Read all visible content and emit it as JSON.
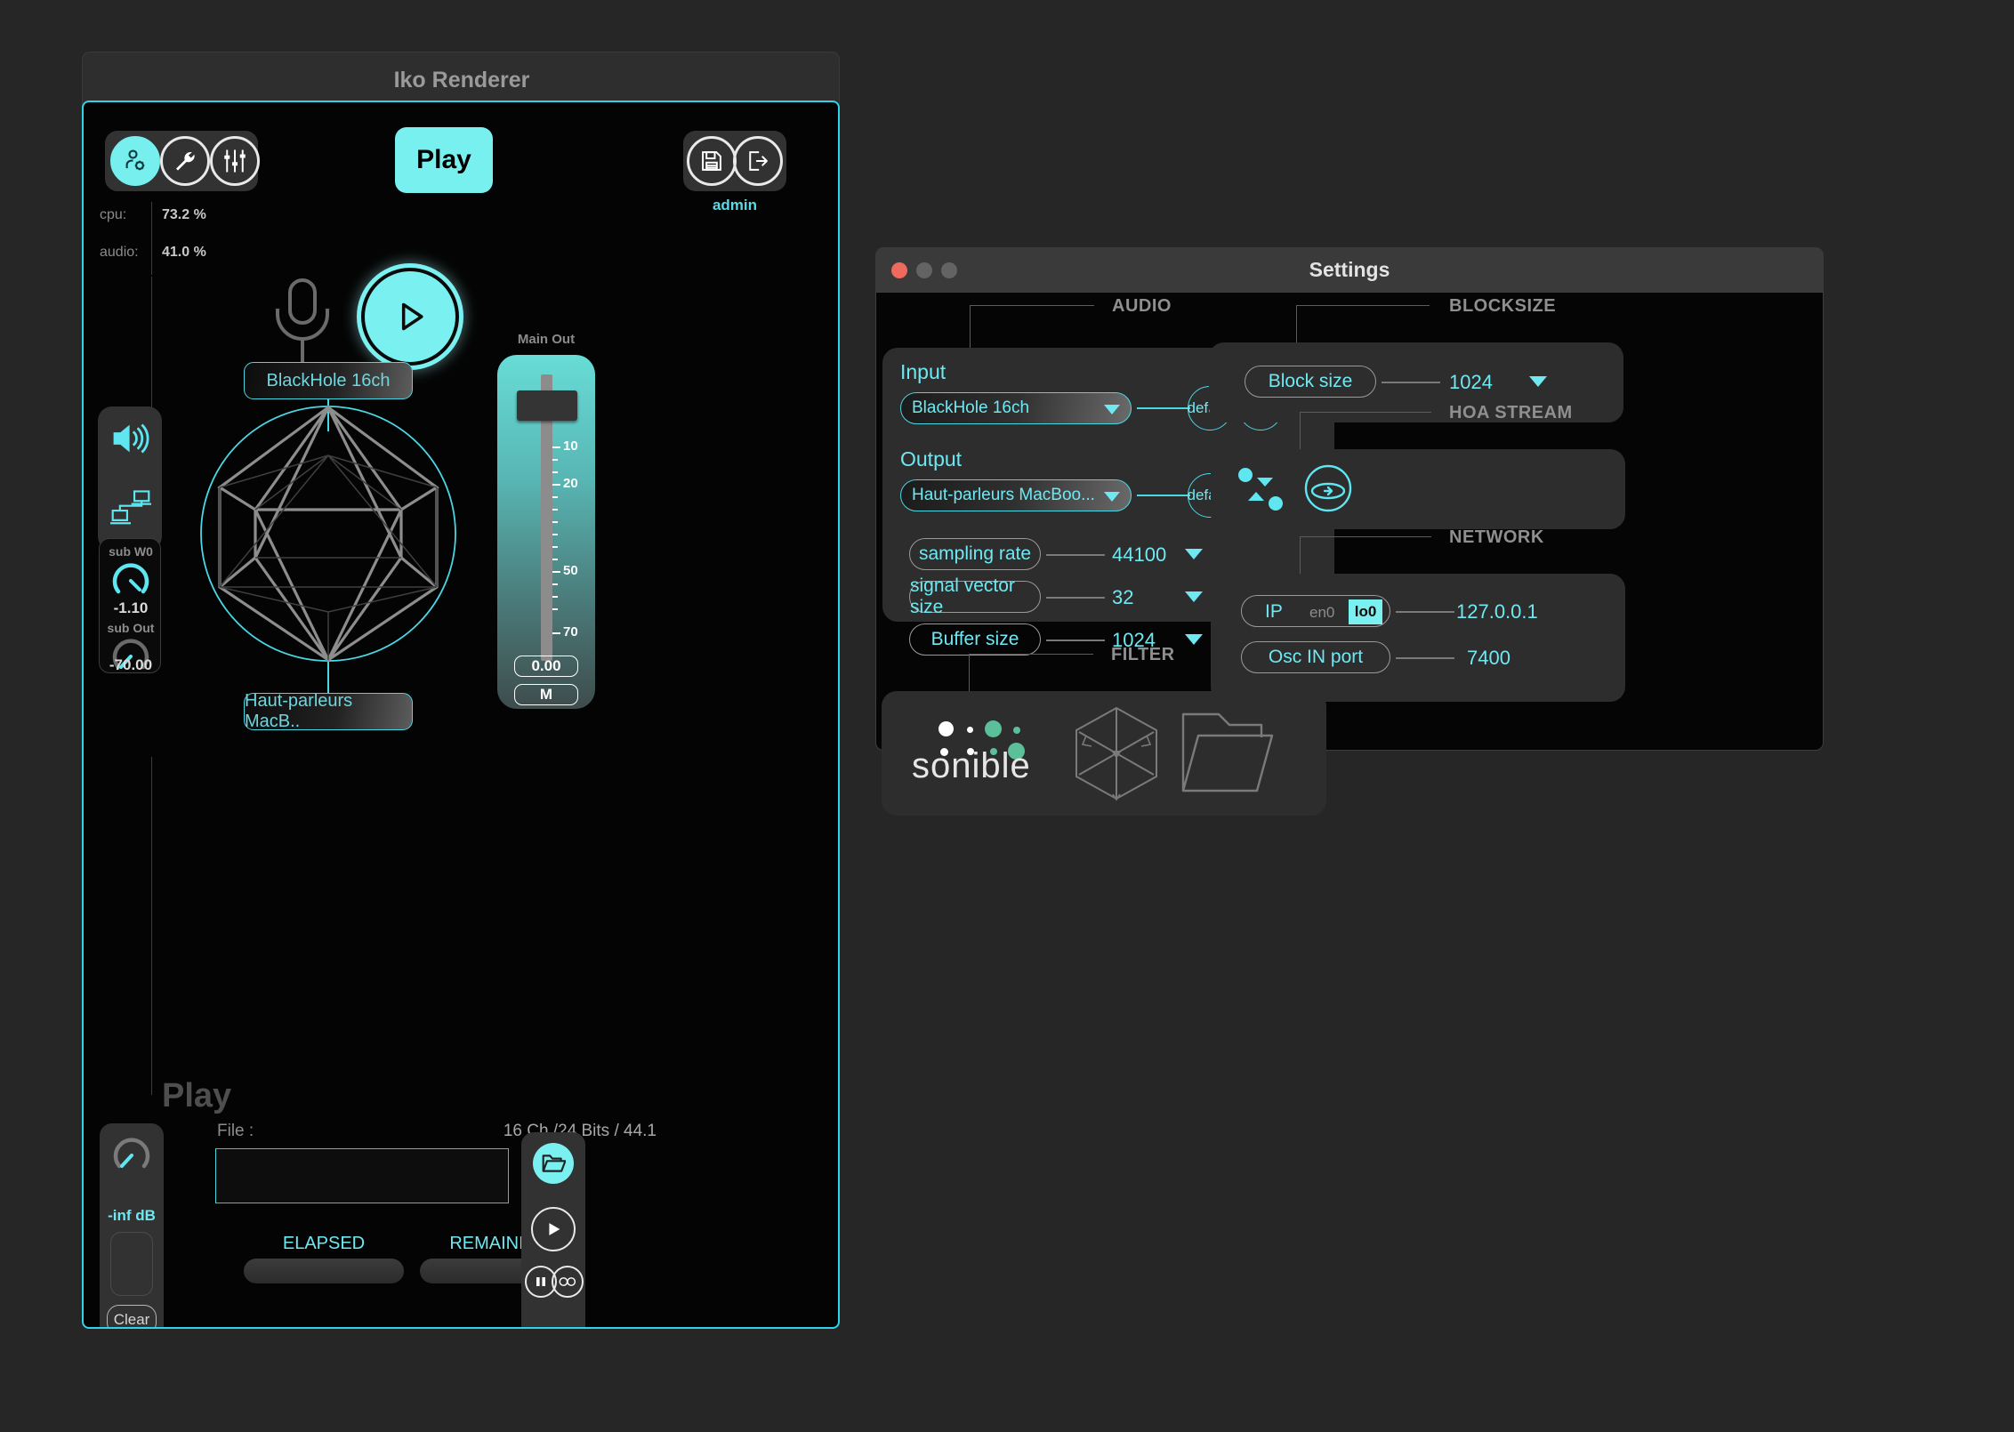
{
  "iko": {
    "title": "Iko Renderer",
    "toolbar_left": [
      {
        "name": "user-settings-icon",
        "active": true
      },
      {
        "name": "wrench-icon",
        "active": false
      },
      {
        "name": "sliders-icon",
        "active": false
      }
    ],
    "toolbar_right": [
      {
        "name": "save-icon"
      },
      {
        "name": "exit-icon"
      }
    ],
    "play_button": "Play",
    "admin_label": "admin",
    "stats": [
      {
        "key": "cpu:",
        "value": "73.2 %"
      },
      {
        "key": "audio:",
        "value": "41.0 %"
      }
    ],
    "input_device_chip": "BlackHole 16ch",
    "output_device_chip": "Haut-parleurs MacB..",
    "knobs": [
      {
        "label": "sub W0",
        "value": "-1.10"
      },
      {
        "label": "sub Out",
        "value": "-70.00"
      }
    ],
    "fader": {
      "label": "Main Out",
      "ticks": [
        "10",
        "20",
        "50",
        "70"
      ],
      "value": "0.00",
      "mute": "M"
    },
    "player": {
      "section_label": "Play",
      "gain_value": "-inf dB",
      "clear_button": "Clear",
      "file_label": "File :",
      "file_meta": "16 Ch  /24 Bits /  44.1",
      "file_value": "",
      "elapsed_label": "ELAPSED",
      "remaining_label": "REMAINING",
      "elapsed_value": "",
      "remaining_value": "",
      "transport": [
        "folder-open-icon",
        "play-icon",
        "pause-icon",
        "loop-icon"
      ]
    }
  },
  "settings": {
    "title": "Settings",
    "traffic_lights": [
      "close",
      "minimize",
      "zoom"
    ],
    "audio": {
      "group_title": "AUDIO",
      "input_label": "Input",
      "input_value": "BlackHole 16ch",
      "input_default": "default",
      "input_reset": "reset",
      "output_label": "Output",
      "output_value": "Haut-parleurs MacBoo...",
      "output_default": "default",
      "output_reset": "reset",
      "rows": [
        {
          "label": "sampling rate",
          "value": "44100"
        },
        {
          "label": "signal vector size",
          "value": "32"
        },
        {
          "label": "Buffer size",
          "value": "1024"
        }
      ]
    },
    "blocksize": {
      "group_title": "BLOCKSIZE",
      "label": "Block size",
      "value": "1024"
    },
    "hoa_stream": {
      "group_title": "HOA STREAM",
      "icons": [
        "updown-arrows-icon",
        "sphere-rotate-icon"
      ]
    },
    "network": {
      "group_title": "NETWORK",
      "ip_label": "IP",
      "iface_en0": "en0",
      "iface_lo0": "lo0",
      "ip_value": "127.0.0.1",
      "port_label": "Osc IN port",
      "port_value": "7400"
    },
    "filter": {
      "group_title": "FILTER",
      "brand": "sonible",
      "icons": [
        "hexagon-direction-icon",
        "folder-icon"
      ]
    }
  },
  "colors": {
    "accent": "#7af0f0",
    "accent_dim": "#4ad7e4",
    "text_cyan": "#6fe8f2",
    "window_bg": "#262626",
    "panel": "#2d2d2d",
    "close_red": "#ee6a5d",
    "sonible_green": "#5bbf9a"
  }
}
